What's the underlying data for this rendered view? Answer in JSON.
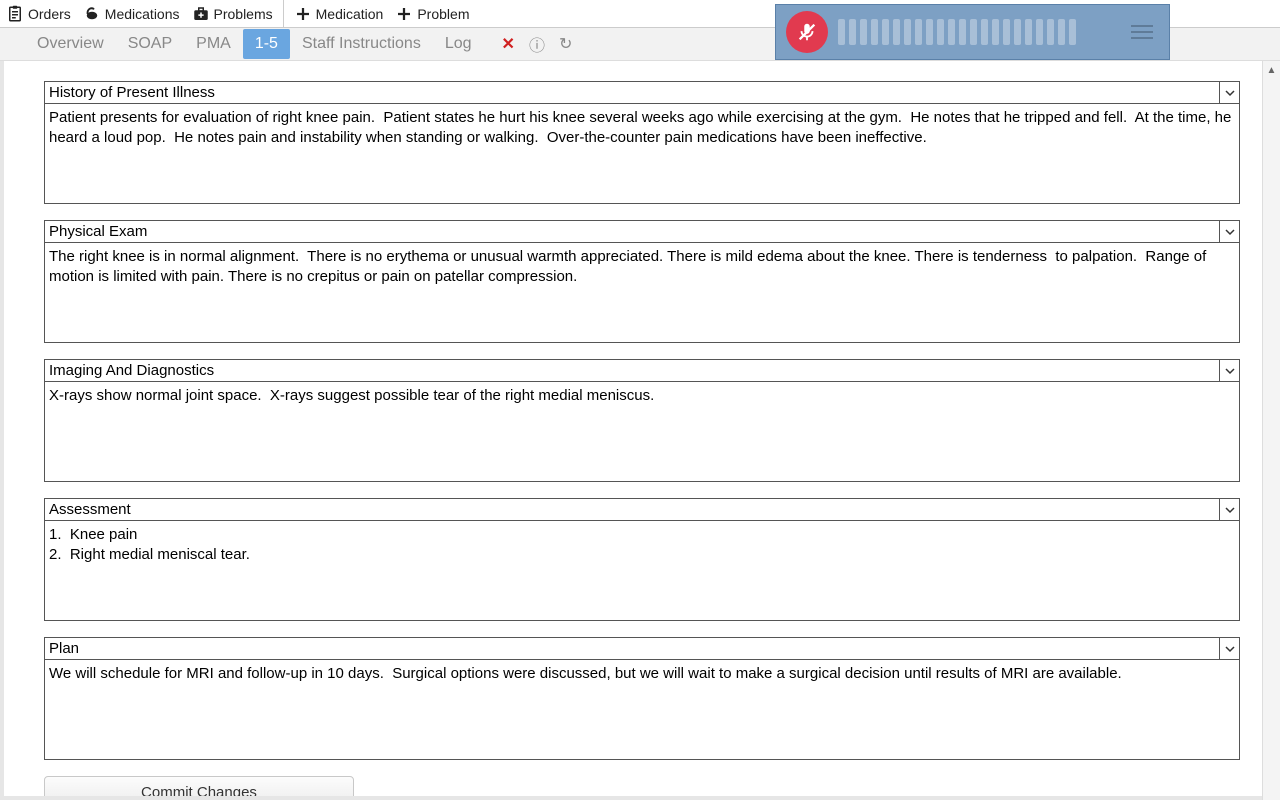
{
  "toolbar": {
    "group1": [
      {
        "label": "Orders",
        "icon": "clipboard"
      },
      {
        "label": "Medications",
        "icon": "pill"
      },
      {
        "label": "Problems",
        "icon": "medkit"
      }
    ],
    "group2": [
      {
        "label": "Medication",
        "icon": "plus"
      },
      {
        "label": "Problem",
        "icon": "plus"
      }
    ]
  },
  "tabs": [
    {
      "label": "Overview",
      "active": false
    },
    {
      "label": "SOAP",
      "active": false
    },
    {
      "label": "PMA",
      "active": false
    },
    {
      "label": "1-5",
      "active": true
    },
    {
      "label": "Staff Instructions",
      "active": false
    },
    {
      "label": "Log",
      "active": false
    }
  ],
  "sections": [
    {
      "title": "History of Present Illness",
      "body": "Patient presents for evaluation of right knee pain.  Patient states he hurt his knee several weeks ago while exercising at the gym.  He notes that he tripped and fell.  At the time, he heard a loud pop.  He notes pain and instability when standing or walking.  Over-the-counter pain medications have been ineffective."
    },
    {
      "title": "Physical Exam",
      "body": "The right knee is in normal alignment.  There is no erythema or unusual warmth appreciated. There is mild edema about the knee. There is tenderness  to palpation.  Range of motion is limited with pain. There is no crepitus or pain on patellar compression."
    },
    {
      "title": "Imaging And Diagnostics",
      "body": "X-rays show normal joint space.  X-rays suggest possible tear of the right medial meniscus."
    },
    {
      "title": "Assessment",
      "body": "1.  Knee pain\n2.  Right medial meniscal tear."
    },
    {
      "title": "Plan",
      "body": "We will schedule for MRI and follow-up in 10 days.  Surgical options were discussed, but we will wait to make a surgical decision until results of MRI are available."
    }
  ],
  "buttons": {
    "commit": "Commit Changes"
  }
}
